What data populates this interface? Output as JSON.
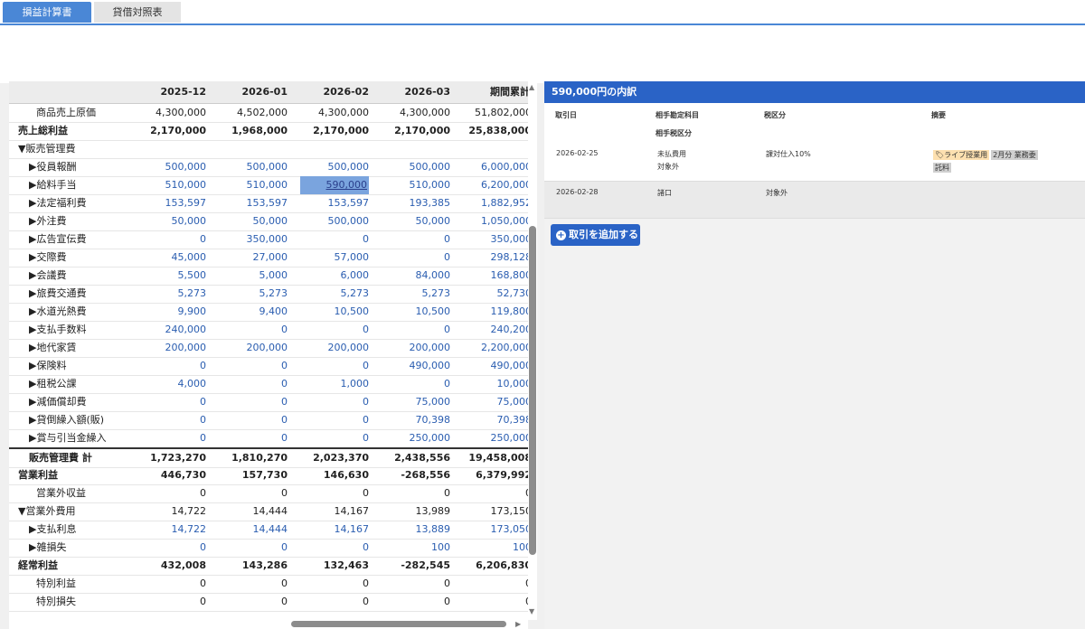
{
  "tabs": [
    "損益計算書",
    "貸借対照表"
  ],
  "table": {
    "columns": [
      "2025-12",
      "2026-01",
      "2026-02",
      "2026-03",
      "期間累計"
    ],
    "rows": [
      {
        "label": "商品売上原価",
        "indent": 2,
        "values": [
          "4,300,000",
          "4,502,000",
          "4,300,000",
          "4,300,000",
          "51,802,000"
        ]
      },
      {
        "label": "売上総利益",
        "indent": 0,
        "bold": true,
        "values": [
          "2,170,000",
          "1,968,000",
          "2,170,000",
          "2,170,000",
          "25,838,000"
        ]
      },
      {
        "label": "▼販売管理費",
        "indent": 0,
        "values": [
          "",
          "",
          "",
          "",
          ""
        ]
      },
      {
        "label": "▶役員報酬",
        "indent": 1,
        "blue": true,
        "values": [
          "500,000",
          "500,000",
          "500,000",
          "500,000",
          "6,000,000"
        ]
      },
      {
        "label": "▶給料手当",
        "indent": 1,
        "blue": true,
        "values": [
          "510,000",
          "510,000",
          "590,000",
          "510,000",
          "6,200,000"
        ]
      },
      {
        "label": "▶法定福利費",
        "indent": 1,
        "blue": true,
        "values": [
          "153,597",
          "153,597",
          "153,597",
          "193,385",
          "1,882,952"
        ]
      },
      {
        "label": "▶外注費",
        "indent": 1,
        "blue": true,
        "values": [
          "50,000",
          "50,000",
          "500,000",
          "50,000",
          "1,050,000"
        ]
      },
      {
        "label": "▶広告宣伝費",
        "indent": 1,
        "blue": true,
        "values": [
          "0",
          "350,000",
          "0",
          "0",
          "350,000"
        ]
      },
      {
        "label": "▶交際費",
        "indent": 1,
        "blue": true,
        "values": [
          "45,000",
          "27,000",
          "57,000",
          "0",
          "298,128"
        ]
      },
      {
        "label": "▶会議費",
        "indent": 1,
        "blue": true,
        "values": [
          "5,500",
          "5,000",
          "6,000",
          "84,000",
          "168,800"
        ]
      },
      {
        "label": "▶旅費交通費",
        "indent": 1,
        "blue": true,
        "values": [
          "5,273",
          "5,273",
          "5,273",
          "5,273",
          "52,730"
        ]
      },
      {
        "label": "▶水道光熱費",
        "indent": 1,
        "blue": true,
        "values": [
          "9,900",
          "9,400",
          "10,500",
          "10,500",
          "119,800"
        ]
      },
      {
        "label": "▶支払手数料",
        "indent": 1,
        "blue": true,
        "values": [
          "240,000",
          "0",
          "0",
          "0",
          "240,200"
        ]
      },
      {
        "label": "▶地代家賃",
        "indent": 1,
        "blue": true,
        "values": [
          "200,000",
          "200,000",
          "200,000",
          "200,000",
          "2,200,000"
        ]
      },
      {
        "label": "▶保険料",
        "indent": 1,
        "blue": true,
        "values": [
          "0",
          "0",
          "0",
          "490,000",
          "490,000"
        ]
      },
      {
        "label": "▶租税公課",
        "indent": 1,
        "blue": true,
        "values": [
          "4,000",
          "0",
          "1,000",
          "0",
          "10,000"
        ]
      },
      {
        "label": "▶減価償却費",
        "indent": 1,
        "blue": true,
        "values": [
          "0",
          "0",
          "0",
          "75,000",
          "75,000"
        ]
      },
      {
        "label": "▶貸倒繰入額(販)",
        "indent": 1,
        "blue": true,
        "values": [
          "0",
          "0",
          "0",
          "70,398",
          "70,398"
        ]
      },
      {
        "label": "▶賞与引当金繰入",
        "indent": 1,
        "blue": true,
        "values": [
          "0",
          "0",
          "0",
          "250,000",
          "250,000"
        ]
      },
      {
        "label": "販売管理費 計",
        "indent": 1,
        "bold": true,
        "topline": true,
        "values": [
          "1,723,270",
          "1,810,270",
          "2,023,370",
          "2,438,556",
          "19,458,008"
        ]
      },
      {
        "label": "営業利益",
        "indent": 0,
        "bold": true,
        "values": [
          "446,730",
          "157,730",
          "146,630",
          "-268,556",
          "6,379,992"
        ]
      },
      {
        "label": "営業外収益",
        "indent": 2,
        "values": [
          "0",
          "0",
          "0",
          "0",
          "0"
        ]
      },
      {
        "label": "▼営業外費用",
        "indent": 0,
        "values": [
          "14,722",
          "14,444",
          "14,167",
          "13,989",
          "173,150"
        ]
      },
      {
        "label": "▶支払利息",
        "indent": 1,
        "blue": true,
        "values": [
          "14,722",
          "14,444",
          "14,167",
          "13,889",
          "173,050"
        ]
      },
      {
        "label": "▶雑損失",
        "indent": 1,
        "blue": true,
        "values": [
          "0",
          "0",
          "0",
          "100",
          "100"
        ]
      },
      {
        "label": "経常利益",
        "indent": 0,
        "bold": true,
        "values": [
          "432,008",
          "143,286",
          "132,463",
          "-282,545",
          "6,206,830"
        ]
      },
      {
        "label": "特別利益",
        "indent": 2,
        "values": [
          "0",
          "0",
          "0",
          "0",
          "0"
        ]
      },
      {
        "label": "特別損失",
        "indent": 2,
        "values": [
          "0",
          "0",
          "0",
          "0",
          "0"
        ]
      }
    ]
  },
  "detail": {
    "title": "590,000円の内訳",
    "headers": {
      "date": "取引日",
      "account": "相手勘定科目",
      "tax_category": "税区分",
      "memo": "摘要",
      "counter_tax": "相手税区分"
    },
    "transactions": [
      {
        "date": "2026-02-25",
        "account": "未払費用",
        "counter_tax": "対象外",
        "tax": "課対仕入10%",
        "tags": [
          "ライブ授業用",
          "2月分 業務委"
        ],
        "extra_tag": "託料"
      },
      {
        "date": "2026-02-28",
        "account": "諸口",
        "counter_tax": "",
        "tax": "対象外",
        "tags": [],
        "extra_tag": ""
      }
    ],
    "add_button": "取引を追加する"
  }
}
